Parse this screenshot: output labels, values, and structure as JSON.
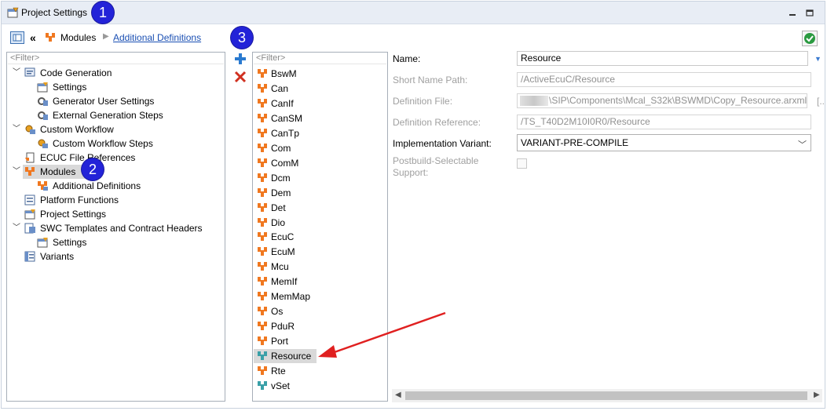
{
  "window": {
    "title": "Project Settings"
  },
  "badges": [
    "1",
    "2",
    "3"
  ],
  "breadcrumb": {
    "root": "Modules",
    "current": "Additional Definitions"
  },
  "left_tree": {
    "filter_placeholder": "<Filter>",
    "items": [
      {
        "label": "Code Generation",
        "icon": "code-generation-icon"
      },
      {
        "label": "Settings",
        "icon": "settings-icon"
      },
      {
        "label": "Generator User Settings",
        "icon": "generator-icon"
      },
      {
        "label": "External Generation Steps",
        "icon": "generator-icon"
      },
      {
        "label": "Custom Workflow",
        "icon": "workflow-icon"
      },
      {
        "label": "Custom Workflow Steps",
        "icon": "workflow-icon"
      },
      {
        "label": "ECUC File References",
        "icon": "file-references-icon"
      },
      {
        "label": "Modules",
        "icon": "module-icon"
      },
      {
        "label": "Additional Definitions",
        "icon": "additional-definitions-icon"
      },
      {
        "label": "Platform Functions",
        "icon": "platform-functions-icon"
      },
      {
        "label": "Project Settings",
        "icon": "project-settings-icon"
      },
      {
        "label": "SWC Templates and Contract Headers",
        "icon": "swc-templates-icon"
      },
      {
        "label": "Settings",
        "icon": "settings-icon"
      },
      {
        "label": "Variants",
        "icon": "variants-icon"
      }
    ]
  },
  "module_list": {
    "filter_placeholder": "<Filter>",
    "items": [
      "BswM",
      "Can",
      "CanIf",
      "CanSM",
      "CanTp",
      "Com",
      "ComM",
      "Dcm",
      "Dem",
      "Det",
      "Dio",
      "EcuC",
      "EcuM",
      "Mcu",
      "MemIf",
      "MemMap",
      "Os",
      "PduR",
      "Port",
      "Resource",
      "Rte",
      "vSet"
    ],
    "selected": "Resource"
  },
  "properties": {
    "name_label": "Name:",
    "name_value": "Resource",
    "short_name_path_label": "Short Name Path:",
    "short_name_path_value": "/ActiveEcuC/Resource",
    "definition_file_label": "Definition File:",
    "definition_file_value": "\\SIP\\Components\\Mcal_S32k\\BSWMD\\Copy_Resource.arxml",
    "definition_file_extra": "[..",
    "definition_reference_label": "Definition Reference:",
    "definition_reference_value": "/TS_T40D2M10I0R0/Resource",
    "implementation_variant_label": "Implementation Variant:",
    "implementation_variant_value": "VARIANT-PRE-COMPILE",
    "postbuild_label_line1": "Postbuild-Selectable",
    "postbuild_label_line2": "Support:"
  },
  "colors": {
    "accent_badge": "#2323d8",
    "arrow": "#e02020",
    "link": "#1a4fb3",
    "module_orange": "#f07820",
    "module_teal": "#3aa0a8"
  }
}
